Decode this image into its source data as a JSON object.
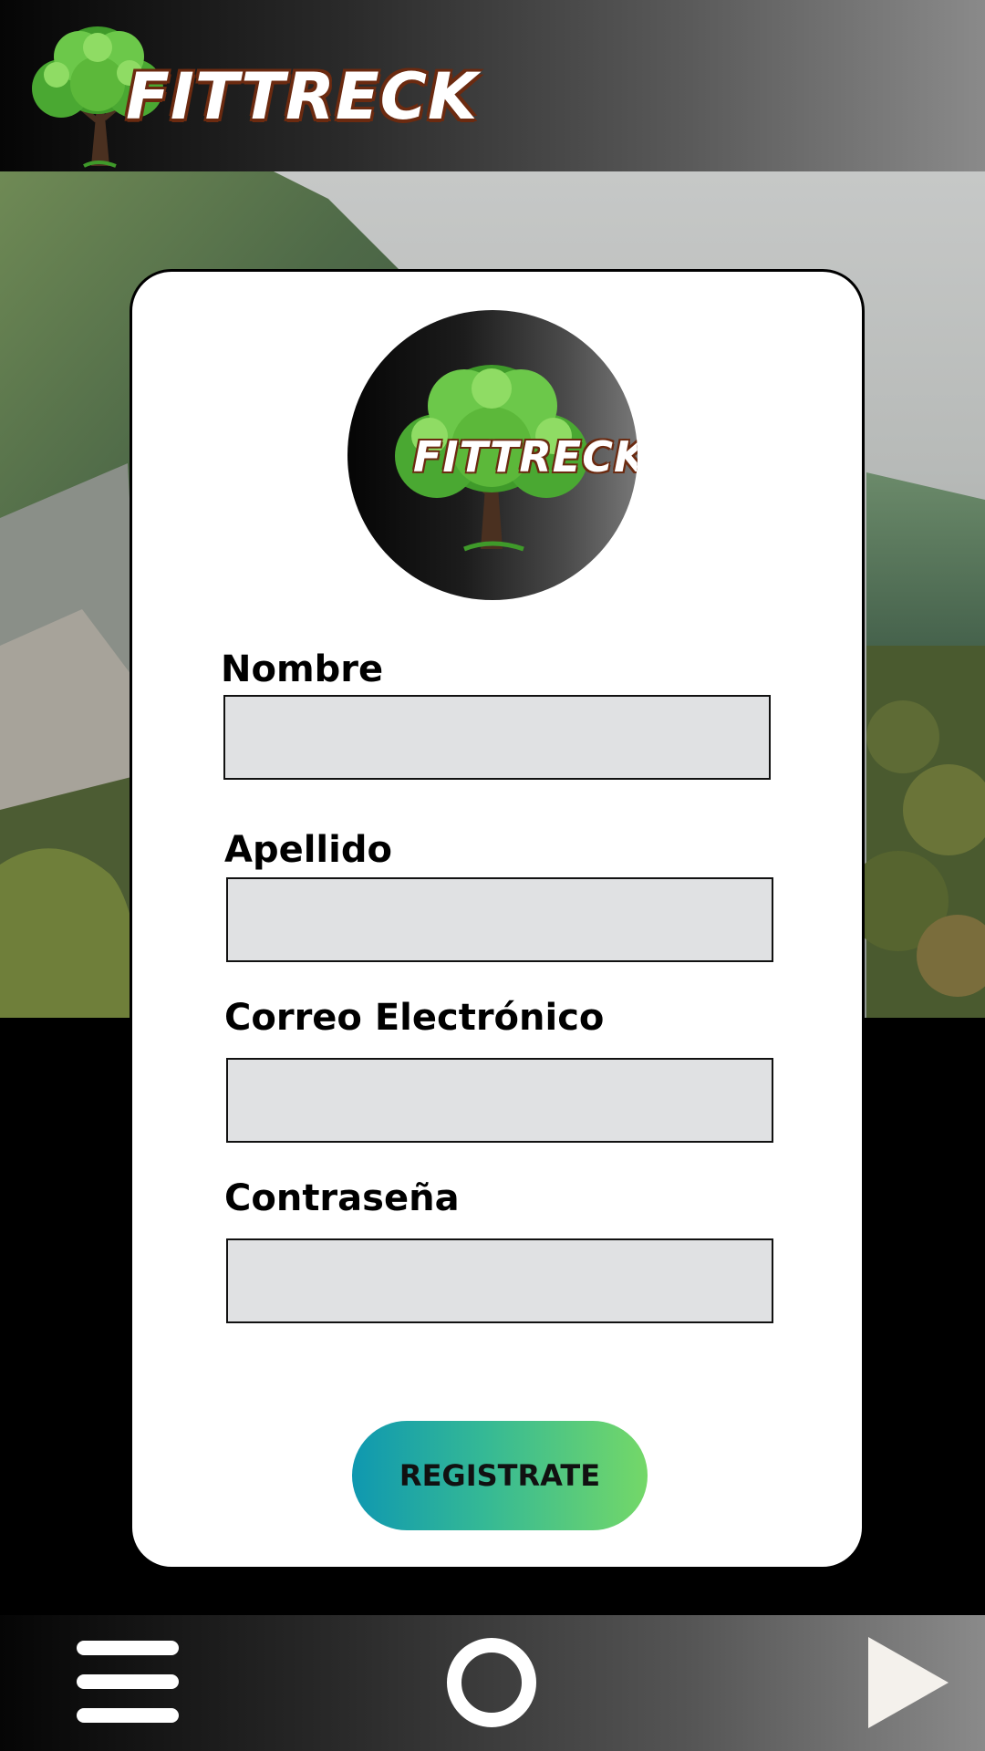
{
  "header": {
    "brand": "FITTRECK",
    "logo_icon": "tree-icon"
  },
  "card": {
    "logo_brand": "FITTRECK",
    "logo_icon": "tree-icon",
    "fields": [
      {
        "label": "Nombre",
        "value": "",
        "placeholder": ""
      },
      {
        "label": "Apellido",
        "value": "",
        "placeholder": ""
      },
      {
        "label": "Correo Electrónico",
        "value": "",
        "placeholder": ""
      },
      {
        "label": "Contraseña",
        "value": "",
        "placeholder": ""
      }
    ],
    "register_label": "REGISTRATE"
  },
  "bottom_nav": {
    "items": [
      {
        "icon": "hamburger-menu-icon"
      },
      {
        "icon": "home-circle-icon"
      },
      {
        "icon": "play-forward-icon"
      }
    ]
  },
  "colors": {
    "button_gradient_start": "#0f98b0",
    "button_gradient_end": "#74d868",
    "input_fill": "#e0e1e3",
    "tree_green": "#5cb83a",
    "text_outline": "#6b2a10"
  }
}
